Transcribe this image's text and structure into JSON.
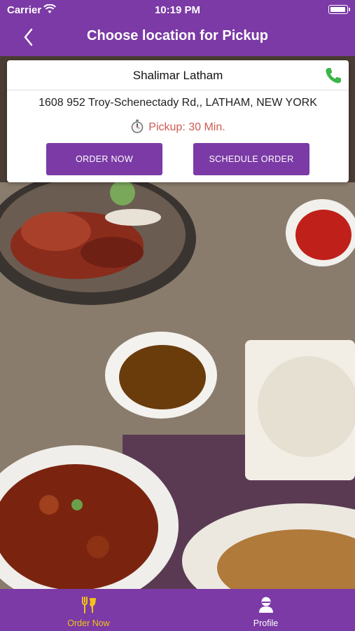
{
  "status_bar": {
    "carrier": "Carrier",
    "time": "10:19 PM"
  },
  "nav": {
    "title": "Choose location for Pickup"
  },
  "location": {
    "name": "Shalimar Latham",
    "address": "1608 952 Troy-Schenectady Rd,, LATHAM, NEW YORK",
    "pickup_text": "Pickup: 30 Min."
  },
  "buttons": {
    "order_now": "ORDER NOW",
    "schedule_order": "SCHEDULE ORDER"
  },
  "tabs": [
    {
      "label": "Order Now",
      "icon": "cutlery-icon",
      "active": true
    },
    {
      "label": "Profile",
      "icon": "person-icon",
      "active": false
    }
  ],
  "colors": {
    "brand_purple": "#7b3aa5",
    "active_tab": "#f2c318",
    "pickup_red": "#d05a50",
    "phone_green": "#3cb54a"
  }
}
